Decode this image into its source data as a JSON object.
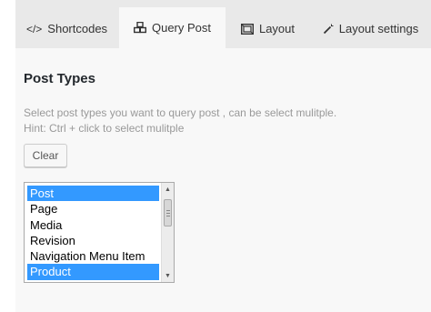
{
  "tabs": [
    {
      "label": "Shortcodes",
      "icon": "code-icon"
    },
    {
      "label": "Query Post",
      "icon": "cubes-icon",
      "active": true
    },
    {
      "label": "Layout",
      "icon": "layout-icon"
    },
    {
      "label": "Layout settings",
      "icon": "magic-wand-icon"
    }
  ],
  "section": {
    "title": "Post Types",
    "description": "Select post types you want to query post , can be select mulitple.",
    "hint": "Hint: Ctrl + click to select mulitple",
    "clear_label": "Clear"
  },
  "post_types": {
    "options": [
      "Post",
      "Page",
      "Media",
      "Revision",
      "Navigation Menu Item",
      "Product"
    ],
    "selected": [
      "Post",
      "Product"
    ]
  },
  "colors": {
    "selection": "#3399ff",
    "tab_bar": "#e9e9e9",
    "active_tab": "#f8f8f8"
  }
}
